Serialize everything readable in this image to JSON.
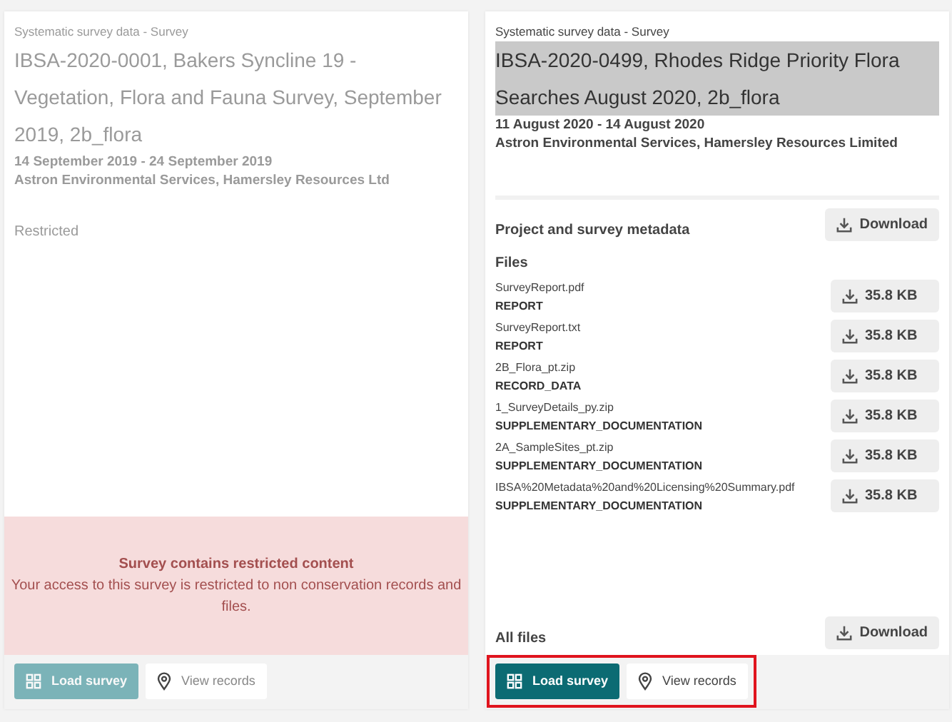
{
  "surveys": [
    {
      "category": "Systematic survey data - Survey",
      "title": "IBSA-2020-0001, Bakers Syncline 19 - Vegetation, Flora and Fauna Survey, September 2019, 2b_flora",
      "title_highlighted": false,
      "dates": "14 September 2019 - 24 September 2019",
      "organisations": "Astron Environmental Services, Hamersley Resources Ltd",
      "restricted": true,
      "access_label": "Restricted",
      "restriction": {
        "heading": "Survey contains restricted content",
        "message": "Your access to this survey is restricted to non conservation records and files."
      },
      "buttons": {
        "load": "Load survey",
        "view": "View records"
      },
      "footer_outlined": false
    },
    {
      "category": "Systematic survey data - Survey",
      "title": "IBSA-2020-0499, Rhodes Ridge Priority Flora Searches August 2020, 2b_flora",
      "title_highlighted": true,
      "dates": "11 August 2020 - 14 August 2020",
      "organisations": "Astron Environmental Services, Hamersley Resources Limited",
      "restricted": false,
      "metadata": {
        "label": "Project and survey metadata",
        "button": "Download"
      },
      "files_heading": "Files",
      "files": [
        {
          "name": "SurveyReport.pdf",
          "type": "REPORT",
          "size": "35.8 KB"
        },
        {
          "name": "SurveyReport.txt",
          "type": "REPORT",
          "size": "35.8 KB"
        },
        {
          "name": "2B_Flora_pt.zip",
          "type": "RECORD_DATA",
          "size": "35.8 KB"
        },
        {
          "name": "1_SurveyDetails_py.zip",
          "type": "SUPPLEMENTARY_DOCUMENTATION",
          "size": "35.8 KB"
        },
        {
          "name": "2A_SampleSites_pt.zip",
          "type": "SUPPLEMENTARY_DOCUMENTATION",
          "size": "35.8 KB"
        },
        {
          "name": "IBSA%20Metadata%20and%20Licensing%20Summary.pdf",
          "type": "SUPPLEMENTARY_DOCUMENTATION",
          "size": "35.8 KB"
        }
      ],
      "all_files": {
        "label": "All files",
        "button": "Download"
      },
      "buttons": {
        "load": "Load survey",
        "view": "View records"
      },
      "footer_outlined": true
    }
  ]
}
